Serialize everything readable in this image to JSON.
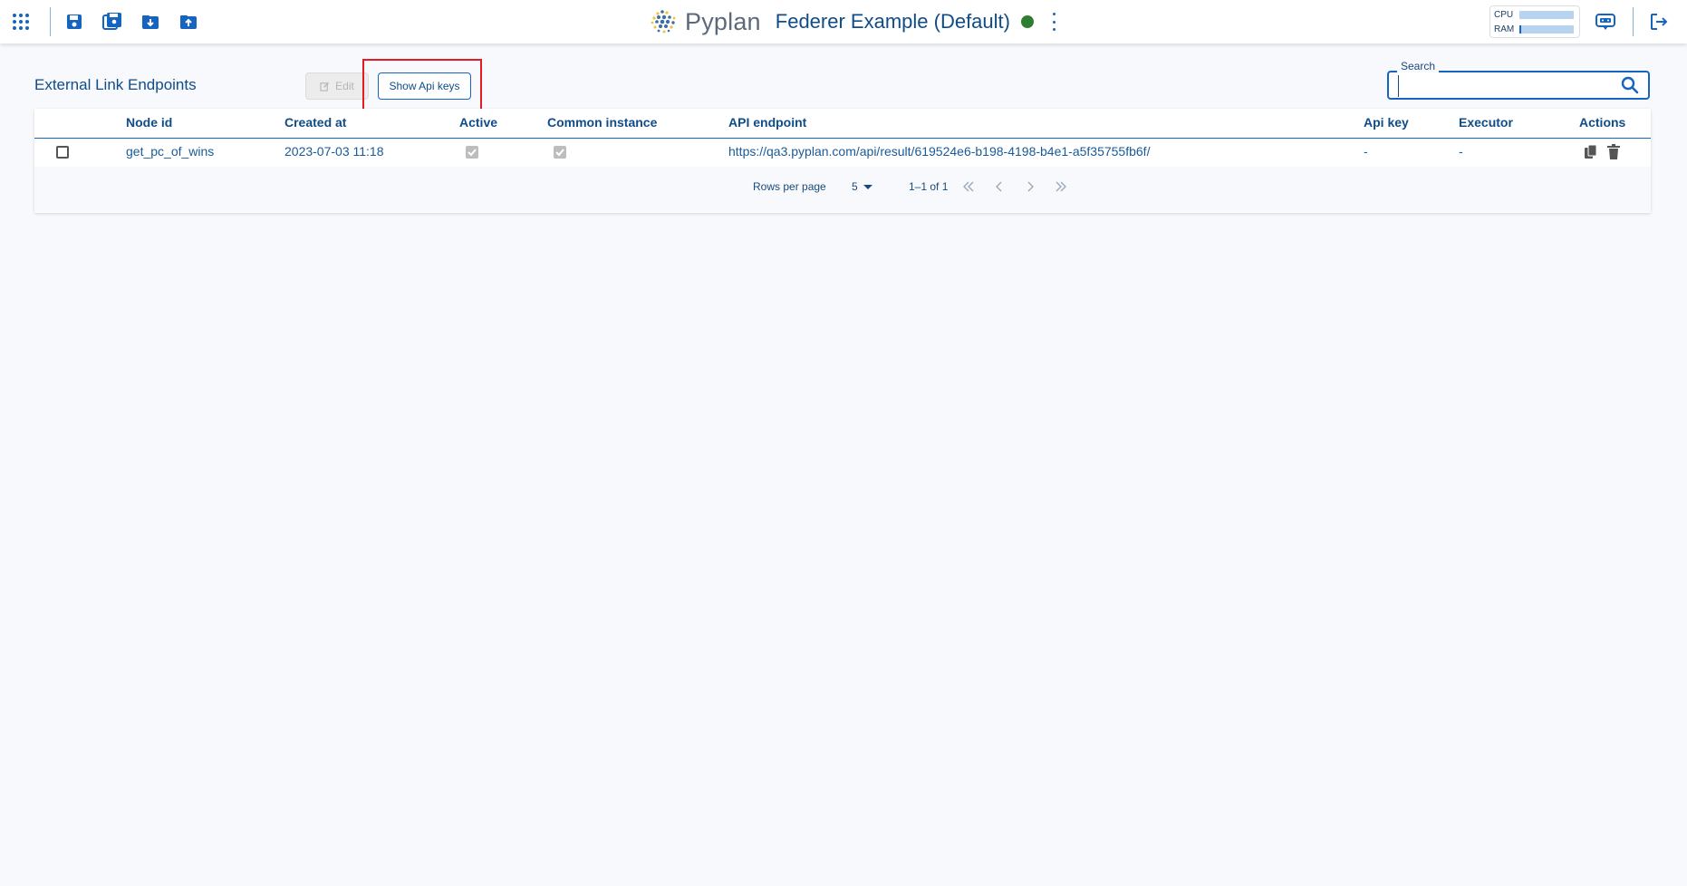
{
  "topbar": {
    "brand": "Pyplan",
    "project_title": "Federer Example (Default)",
    "status_color": "#2e7d32",
    "resources": {
      "cpu_label": "CPU",
      "ram_label": "RAM",
      "cpu_fraction": 0.0,
      "ram_fraction": 0.04
    },
    "icons": [
      "apps-grid-icon",
      "save-icon",
      "save-as-icon",
      "download-icon",
      "upload-icon",
      "chat-bot-icon",
      "logout-icon"
    ]
  },
  "page": {
    "title": "External Link Endpoints",
    "edit_label": "Edit",
    "show_api_keys_label": "Show Api keys",
    "search": {
      "label": "Search",
      "value": ""
    }
  },
  "table": {
    "columns": [
      "Node id",
      "Created at",
      "Active",
      "Common instance",
      "API endpoint",
      "Api key",
      "Executor",
      "Actions"
    ],
    "rows": [
      {
        "node_id": "get_pc_of_wins",
        "created_at": "2023-07-03 11:18",
        "active": true,
        "common_instance": true,
        "api_endpoint": "https://qa3.pyplan.com/api/result/619524e6-b198-4198-b4e1-a5f35755fb6f/",
        "api_key": "-",
        "executor": "-"
      }
    ],
    "footer": {
      "rows_per_page_label": "Rows per page",
      "rows_per_page_value": "5",
      "range_text": "1–1 of 1"
    }
  },
  "colors": {
    "accent": "#1565c0",
    "text": "#0f4c88",
    "highlight": "#e31b23"
  }
}
